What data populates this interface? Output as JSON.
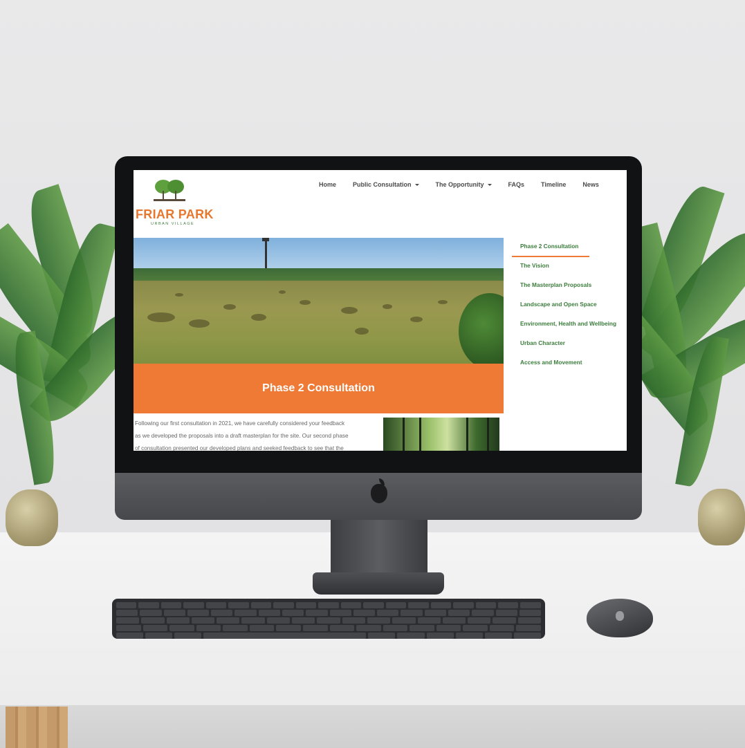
{
  "brand": {
    "name": "FRIAR PARK",
    "tagline": "URBAN VILLAGE",
    "primary_color": "#ee7a35",
    "secondary_color": "#3b7d3c"
  },
  "nav": {
    "items": [
      {
        "label": "Home",
        "has_dropdown": false
      },
      {
        "label": "Public Consultation",
        "has_dropdown": true
      },
      {
        "label": "The Opportunity",
        "has_dropdown": true
      },
      {
        "label": "FAQs",
        "has_dropdown": false
      },
      {
        "label": "Timeline",
        "has_dropdown": false
      },
      {
        "label": "News",
        "has_dropdown": false
      }
    ]
  },
  "banner": {
    "title": "Phase 2 Consultation"
  },
  "intro": {
    "lines": [
      "Following our first consultation in 2021, we have carefully considered your feedback",
      "as we developed the proposals into a draft masterplan for the site. Our second phase",
      "of consultation presented our developed plans and seeked feedback to see that the"
    ]
  },
  "sidebar": {
    "items": [
      {
        "label": "Phase 2 Consultation",
        "active": true
      },
      {
        "label": "The Vision",
        "active": false
      },
      {
        "label": "The Masterplan Proposals",
        "active": false
      },
      {
        "label": "Landscape and Open Space",
        "active": false
      },
      {
        "label": "Environment, Health and Wellbeing",
        "active": false
      },
      {
        "label": "Urban Character",
        "active": false
      },
      {
        "label": "Access and Movement",
        "active": false
      }
    ]
  }
}
